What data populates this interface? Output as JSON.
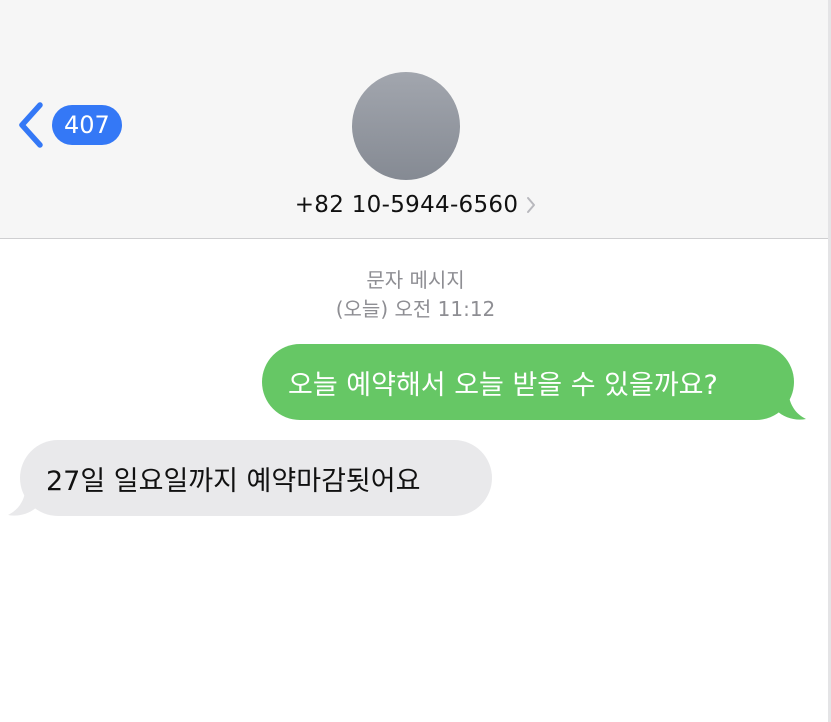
{
  "header": {
    "back_badge": "407",
    "contact_number": "+82 10-5944-6560"
  },
  "thread": {
    "type_label": "문자 메시지",
    "timestamp": "(오늘) 오전 11:12"
  },
  "messages": [
    {
      "direction": "outgoing",
      "text": "오늘 예약해서 오늘 받을 수 있을까요?"
    },
    {
      "direction": "incoming",
      "text": "27일 일요일까지 예약마감됫어요"
    }
  ],
  "colors": {
    "accent": "#3478f6",
    "outgoing_bubble": "#66c765",
    "incoming_bubble": "#e9e9eb",
    "header_bg": "#f6f6f6",
    "meta_text": "#8e8e93"
  },
  "icons": {
    "back": "chevron-left-icon",
    "contact_detail": "chevron-right-icon"
  }
}
